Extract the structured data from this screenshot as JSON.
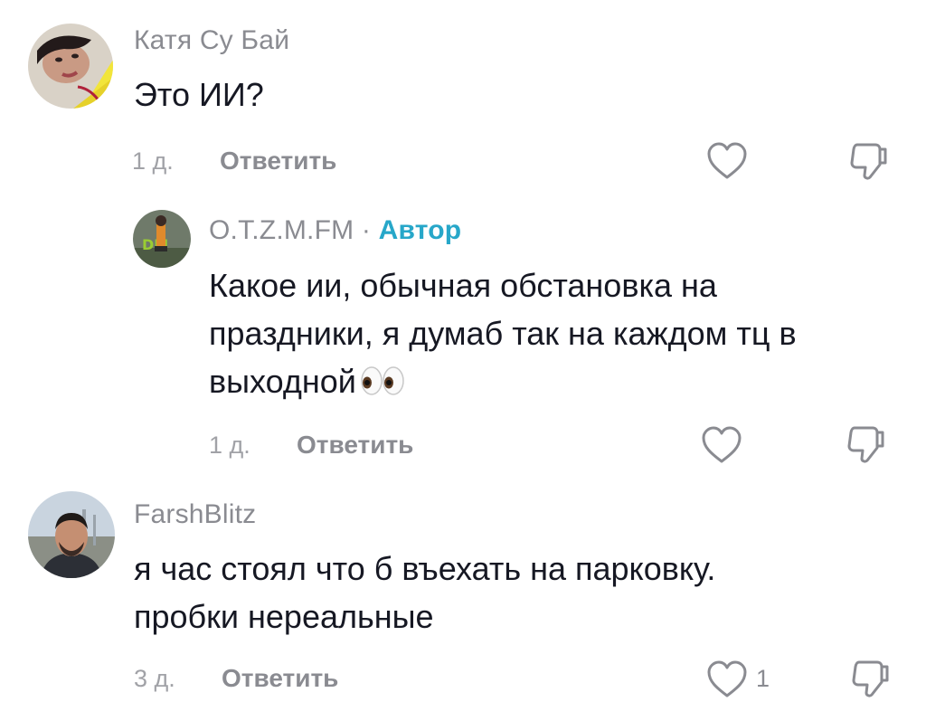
{
  "colors": {
    "username": "#8a8b91",
    "author_badge": "#27a7c9",
    "text": "#161823",
    "meta": "#a1a2a7",
    "icon_stroke": "#8a8b91"
  },
  "icons": {
    "like": "heart-outline-icon",
    "dislike": "thumb-down-outline-icon"
  },
  "comments": [
    {
      "username": "Катя Су Бай",
      "text_lines": [
        "Это ИИ?"
      ],
      "time": "1 д.",
      "reply_label": "Ответить",
      "like_count": ""
    },
    {
      "username": "O.T.Z.M.FM",
      "separator": "·",
      "author_badge": "Автор",
      "text_lines": [
        "Какое ии, обычная обстановка на",
        "праздники, я думаб так на каждом тц в",
        "выходной"
      ],
      "emoji": "👀",
      "time": "1 д.",
      "reply_label": "Ответить",
      "like_count": ""
    },
    {
      "username": "FarshBlitz",
      "text_lines": [
        "я час стоял что б въехать на парковку.",
        "пробки нереальные"
      ],
      "time": "3 д.",
      "reply_label": "Ответить",
      "like_count": "1"
    }
  ]
}
